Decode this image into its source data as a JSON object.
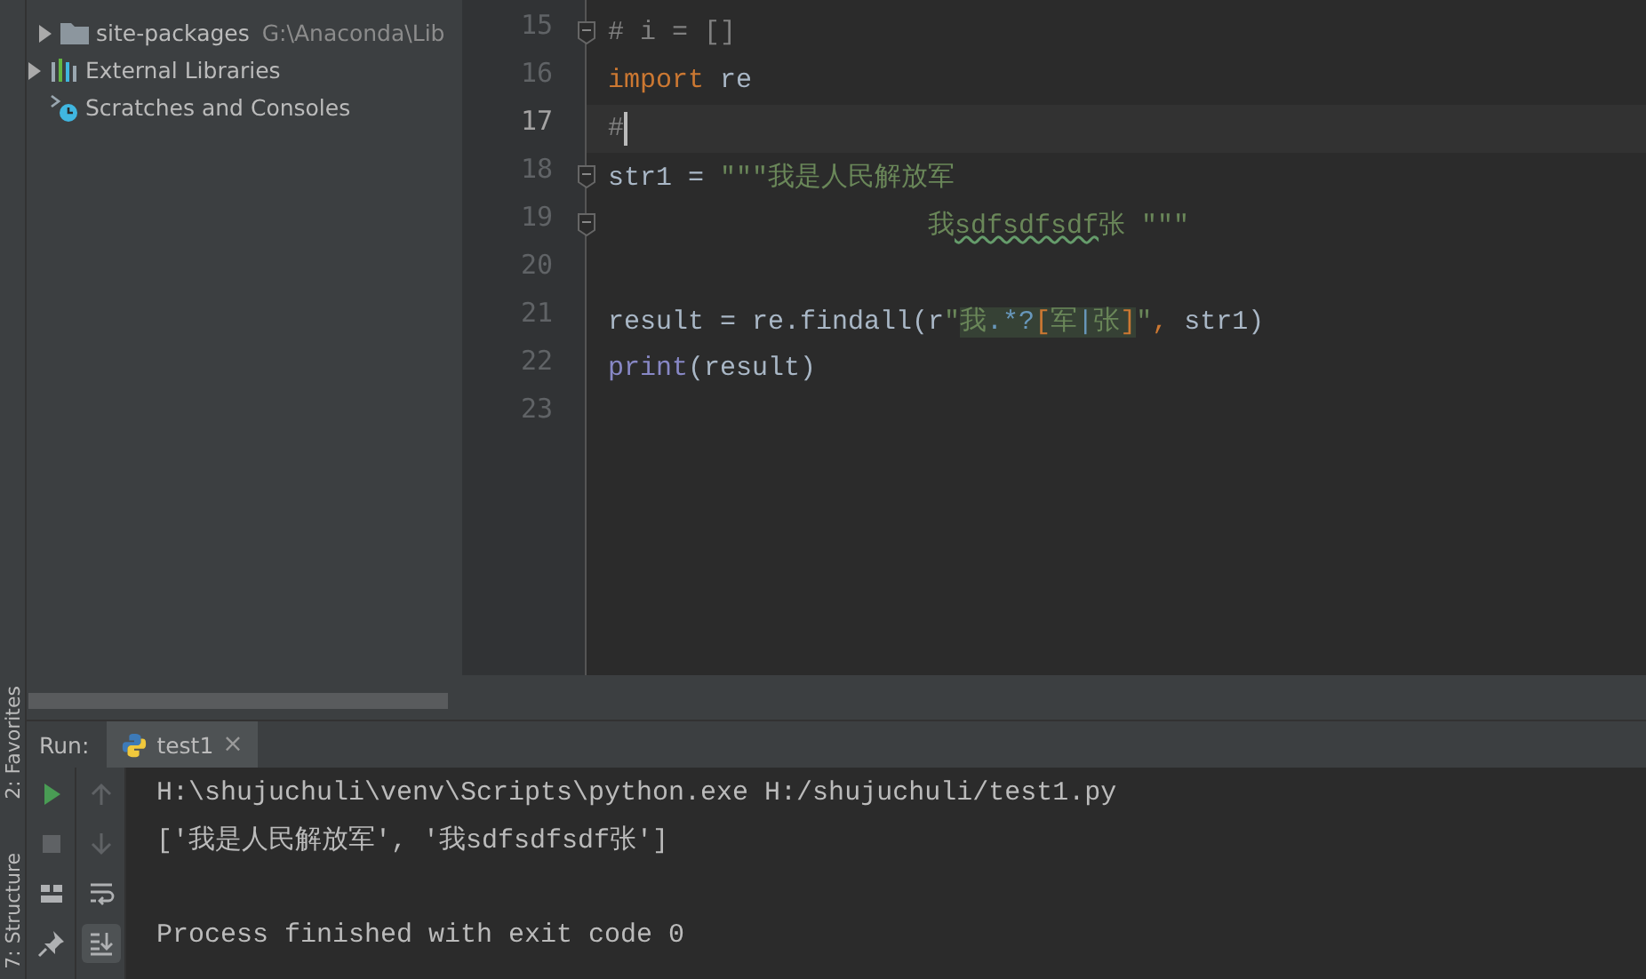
{
  "side_strip": {
    "tools": [
      "2: Favorites",
      "7: Structure"
    ]
  },
  "project_tree": [
    {
      "children": [
        {
          "label": "site-packages",
          "detail": "G:\\Anaconda\\Lib",
          "kind": "folder",
          "expanded": false
        }
      ]
    },
    {
      "label": "External Libraries",
      "kind": "libraries",
      "expanded": false
    },
    {
      "label": "Scratches and Consoles",
      "kind": "scratches"
    }
  ],
  "editor": {
    "lines": [
      {
        "number": "15",
        "fold": true,
        "current": false,
        "tokens": [
          {
            "kind": "comment",
            "text": "# i = []"
          }
        ]
      },
      {
        "number": "16",
        "fold": false,
        "current": false,
        "tokens": [
          {
            "kind": "keyword",
            "text": "import"
          },
          {
            "kind": "plain",
            "text": " re"
          }
        ]
      },
      {
        "number": "17",
        "fold": false,
        "current": true,
        "tokens": [
          {
            "kind": "comment",
            "text": "#"
          }
        ]
      },
      {
        "number": "18",
        "fold": true,
        "current": false,
        "tokens": [
          {
            "kind": "plain",
            "text": "str1 = "
          },
          {
            "kind": "string",
            "text": "\"\"\"我是人民解放军"
          }
        ]
      },
      {
        "number": "19",
        "fold": true,
        "current": false,
        "tokens": [
          {
            "kind": "string",
            "text": "                    我"
          },
          {
            "kind": "typo",
            "text": "sdfsdfsdf"
          },
          {
            "kind": "string",
            "text": "张 \"\"\""
          }
        ]
      },
      {
        "number": "20",
        "fold": false,
        "current": false
      },
      {
        "number": "21",
        "fold": false,
        "current": false,
        "tokens": [
          {
            "kind": "plain",
            "text": "result = re.findall(r"
          },
          {
            "kind": "string",
            "text": "\""
          },
          {
            "kind": "regex",
            "text": "我"
          },
          {
            "kind": "regex_meta",
            "text": ".*?"
          },
          {
            "kind": "regex_bracket",
            "text": "["
          },
          {
            "kind": "regex",
            "text": "军"
          },
          {
            "kind": "regex_meta",
            "text": "|"
          },
          {
            "kind": "regex",
            "text": "张"
          },
          {
            "kind": "regex_bracket",
            "text": "]"
          },
          {
            "kind": "string",
            "text": "\""
          },
          {
            "kind": "keyword",
            "text": ","
          },
          {
            "kind": "plain",
            "text": " str1)"
          }
        ]
      },
      {
        "number": "22",
        "fold": false,
        "current": false,
        "tokens": [
          {
            "kind": "builtin",
            "text": "print"
          },
          {
            "kind": "plain",
            "text": "(result)"
          }
        ]
      },
      {
        "number": "23",
        "fold": false,
        "current": false
      }
    ]
  },
  "run_panel": {
    "label": "Run:",
    "tabs": [
      {
        "label": "test1",
        "close": "×",
        "selected": true
      }
    ],
    "toolbar": [
      {
        "kind": "play",
        "disabled": false
      },
      {
        "kind": "stop",
        "disabled": true
      },
      {
        "kind": "layout",
        "disabled": false
      },
      {
        "kind": "pin",
        "disabled": false
      }
    ],
    "toolbar_2": [
      {
        "kind": "up",
        "disabled": true,
        "selected": false
      },
      {
        "kind": "down",
        "disabled": true,
        "selected": false
      },
      {
        "kind": "wrap",
        "disabled": false,
        "selected": false
      },
      {
        "kind": "scroll-end",
        "disabled": false,
        "selected": true
      }
    ],
    "console": [
      {
        "kind": "command",
        "text": "H:\\shujuchuli\\venv\\Scripts\\python.exe H:/shujuchuli/test1.py"
      },
      {
        "kind": "output",
        "text": "['我是人民解放军', '我sdfsdfsdf张']"
      },
      {
        "kind": "exit",
        "text": "Process finished with exit code 0"
      }
    ]
  }
}
